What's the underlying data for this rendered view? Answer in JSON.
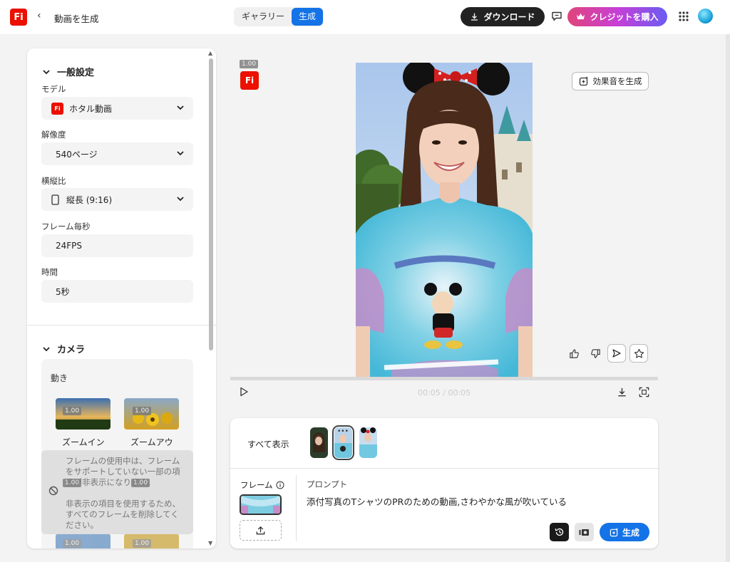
{
  "app": {
    "logo_text": "Fi",
    "page_title": "動画を生成"
  },
  "topbar": {
    "tabs": [
      {
        "label": "ギャラリー"
      },
      {
        "label": "生成"
      }
    ],
    "download_label": "ダウンロード",
    "buy_credits_label": "クレジットを購入"
  },
  "settings": {
    "general_title": "一般設定",
    "model_label": "モデル",
    "model_value": "ホタル動画",
    "resolution_label": "解像度",
    "resolution_value": "540ページ",
    "aspect_label": "横縦比",
    "aspect_value": "縦長 (9:16)",
    "fps_label": "フレーム毎秒",
    "fps_value": "24FPS",
    "duration_label": "時間",
    "duration_value": "5秒"
  },
  "camera": {
    "title": "カメラ",
    "motion_label": "動き",
    "options": [
      {
        "label": "ズームイン"
      },
      {
        "label": "ズームアウ"
      }
    ],
    "tooltip_line1": "フレームの使用中は、フレームをサポートしていない一部の項目が非表示になります。",
    "tooltip_line2": "非表示の項目を使用するため、すべてのフレームを削除してください。"
  },
  "badges": {
    "version": "1.00"
  },
  "preview": {
    "sfx_label": "効果音を生成",
    "time_current": "00:05",
    "time_separator": " / ",
    "time_total": "00:05"
  },
  "bottom": {
    "show_all_label": "すべて表示",
    "frame_label": "フレーム",
    "prompt_label": "プロンプト",
    "prompt_text": "添付写真のTシャツのPRのための動画,さわやかな風が吹いている",
    "generate_label": "生成"
  },
  "colors": {
    "accent": "#1473e6",
    "brand": "#eb1000",
    "dark_button": "#222222"
  }
}
